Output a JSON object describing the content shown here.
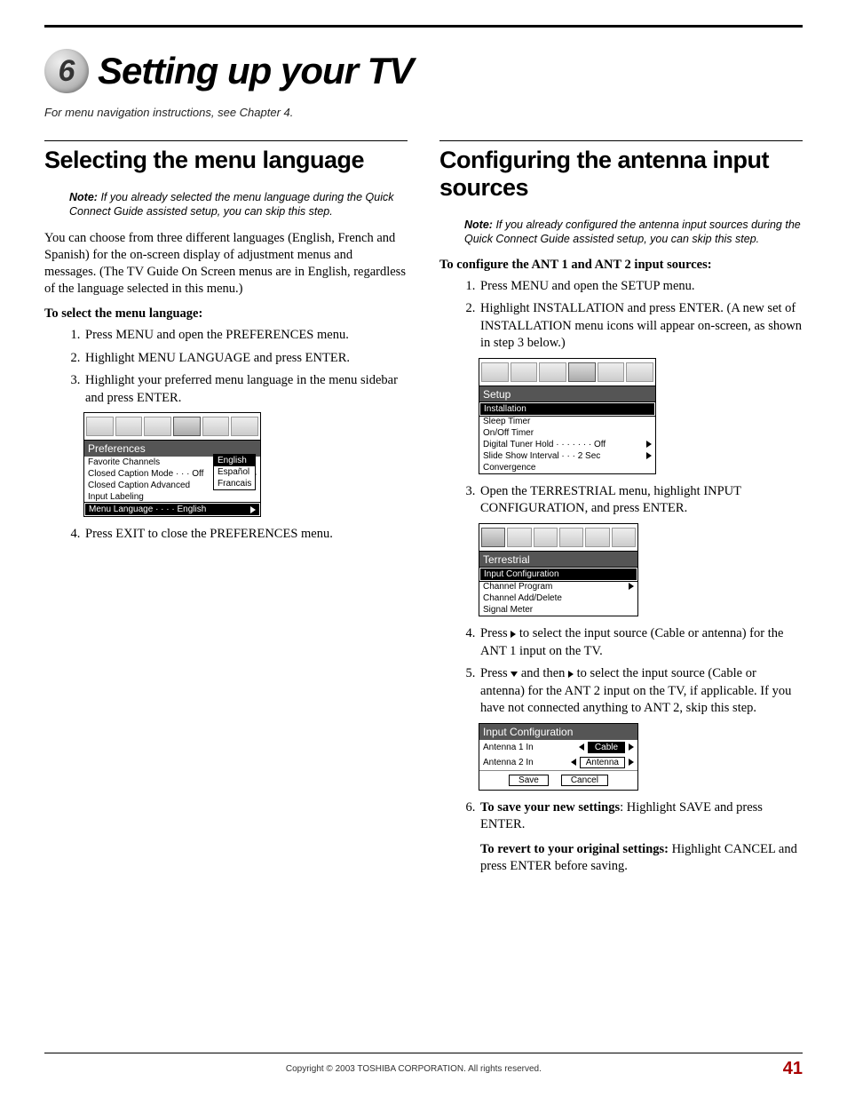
{
  "chapter": {
    "number": "6",
    "title": "Setting up your TV"
  },
  "nav_instr": "For menu navigation instructions, see Chapter 4.",
  "left": {
    "heading": "Selecting the menu language",
    "note_label": "Note:",
    "note": "If you already selected the menu language during the Quick Connect Guide assisted setup, you can skip this step.",
    "intro": "You can choose from three different languages (English, French and Spanish) for the on-screen display of adjustment menus and messages. (The TV Guide On Screen menus are in English, regardless of the language selected in this menu.)",
    "subhead": "To select the menu language:",
    "steps": [
      "Press MENU and open the PREFERENCES menu.",
      "Highlight MENU LANGUAGE and press ENTER.",
      "Highlight your preferred menu language in the menu sidebar and press ENTER."
    ],
    "step4": "Press EXIT to close the PREFERENCES menu.",
    "osd": {
      "title": "Preferences",
      "rows": [
        {
          "label": "Favorite Channels",
          "value": ""
        },
        {
          "label": "Closed Caption Mode",
          "value": "Off",
          "arrow": true
        },
        {
          "label": "Closed Caption Advanced",
          "value": ""
        },
        {
          "label": "Input Labeling",
          "value": ""
        },
        {
          "label": "Menu Language",
          "value": "English",
          "arrow": true,
          "selected": true
        }
      ],
      "popup": [
        "English",
        "Español",
        "Francais"
      ],
      "popup_selected": 0
    }
  },
  "right": {
    "heading": "Configuring the antenna input sources",
    "note_label": "Note:",
    "note": "If you already configured the antenna input sources during the Quick Connect Guide assisted setup, you can skip this step.",
    "subhead": "To configure the ANT 1 and ANT 2 input sources:",
    "steps12": [
      "Press MENU and open the SETUP menu.",
      "Highlight INSTALLATION and press ENTER. (A new set of INSTALLATION menu icons will appear on-screen, as shown in step 3 below.)"
    ],
    "osd_setup": {
      "title": "Setup",
      "rows": [
        {
          "label": "Installation",
          "selected": true
        },
        {
          "label": "Sleep Timer"
        },
        {
          "label": "On/Off Timer"
        },
        {
          "label": "Digital Tuner Hold",
          "value": "Off",
          "arrow": true
        },
        {
          "label": "Slide Show Interval",
          "value": "2 Sec",
          "arrow": true
        },
        {
          "label": "Convergence"
        }
      ]
    },
    "step3": "Open the TERRESTRIAL menu, highlight INPUT CONFIGURATION, and press ENTER.",
    "osd_terrestrial": {
      "title": "Terrestrial",
      "rows": [
        {
          "label": "Input Configuration",
          "selected": true
        },
        {
          "label": "Channel Program",
          "arrow": true
        },
        {
          "label": "Channel Add/Delete"
        },
        {
          "label": "Signal Meter"
        }
      ]
    },
    "step4_pre": "Press ",
    "step4_post": " to select the input source (Cable or antenna) for the ANT 1 input on the TV.",
    "step5_pre": "Press ",
    "step5_mid": " and then ",
    "step5_post": " to select the input source (Cable or antenna) for the ANT 2 input on the TV, if applicable. If you have not connected anything to ANT 2, skip this step.",
    "osd_inputcfg": {
      "title": "Input Configuration",
      "rows": [
        {
          "label": "Antenna 1 In",
          "value": "Cable",
          "selected": true
        },
        {
          "label": "Antenna 2 In",
          "value": "Antenna"
        }
      ],
      "buttons": [
        "Save",
        "Cancel"
      ]
    },
    "step6_a_bold": "To save your new settings",
    "step6_a_rest": ": Highlight SAVE and press ENTER.",
    "step6_b_bold": "To revert to your original settings:",
    "step6_b_rest": " Highlight CANCEL and press ENTER before saving."
  },
  "footer": {
    "copyright": "Copyright © 2003 TOSHIBA CORPORATION. All rights reserved.",
    "page": "41"
  }
}
